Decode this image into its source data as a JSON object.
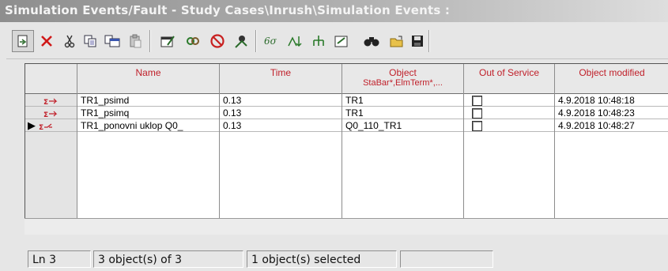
{
  "window": {
    "title": "Simulation Events/Fault - Study Cases\\Inrush\\Simulation Events :"
  },
  "toolbar": {
    "buttons": [
      {
        "icon": "new-object-icon"
      },
      {
        "icon": "delete-icon"
      },
      {
        "icon": "cut-icon"
      },
      {
        "icon": "copy-icon"
      },
      {
        "icon": "copy-with-header-icon"
      },
      {
        "icon": "paste-icon"
      },
      {
        "icon": "edit-icon"
      },
      {
        "icon": "link-icon"
      },
      {
        "icon": "out-of-service-icon"
      },
      {
        "icon": "mark-graphic-icon"
      },
      {
        "icon": "variables-icon"
      },
      {
        "icon": "sort-icon"
      },
      {
        "icon": "hierarchy-icon"
      },
      {
        "icon": "detail-mode-icon"
      },
      {
        "icon": "find-icon"
      },
      {
        "icon": "open-folder-icon"
      },
      {
        "icon": "save-icon"
      }
    ]
  },
  "table": {
    "headers": {
      "name": "Name",
      "time": "Time",
      "object_line1": "Object",
      "object_line2": "StaBar*,ElmTerm*,...",
      "out_of_service": "Out of Service",
      "modified": "Object modified"
    },
    "rows": [
      {
        "marker": "",
        "name": "TR1_psimd",
        "time": "0.13",
        "object": "TR1",
        "out_of_service": false,
        "modified": "4.9.2018 10:48:18"
      },
      {
        "marker": "",
        "name": "TR1_psimq",
        "time": "0.13",
        "object": "TR1",
        "out_of_service": false,
        "modified": "4.9.2018 10:48:23"
      },
      {
        "marker": "▶",
        "name": "TR1_ponovni uklop Q0_",
        "time": "0.13",
        "object": "Q0_110_TR1",
        "out_of_service": false,
        "modified": "4.9.2018 10:48:27"
      }
    ]
  },
  "status": {
    "line": "Ln 3",
    "count": "3 object(s) of 3",
    "selected": "1 object(s) selected",
    "extra": ""
  },
  "colors": {
    "header_text": "#c0202a",
    "event_icon": "#c0202a"
  }
}
